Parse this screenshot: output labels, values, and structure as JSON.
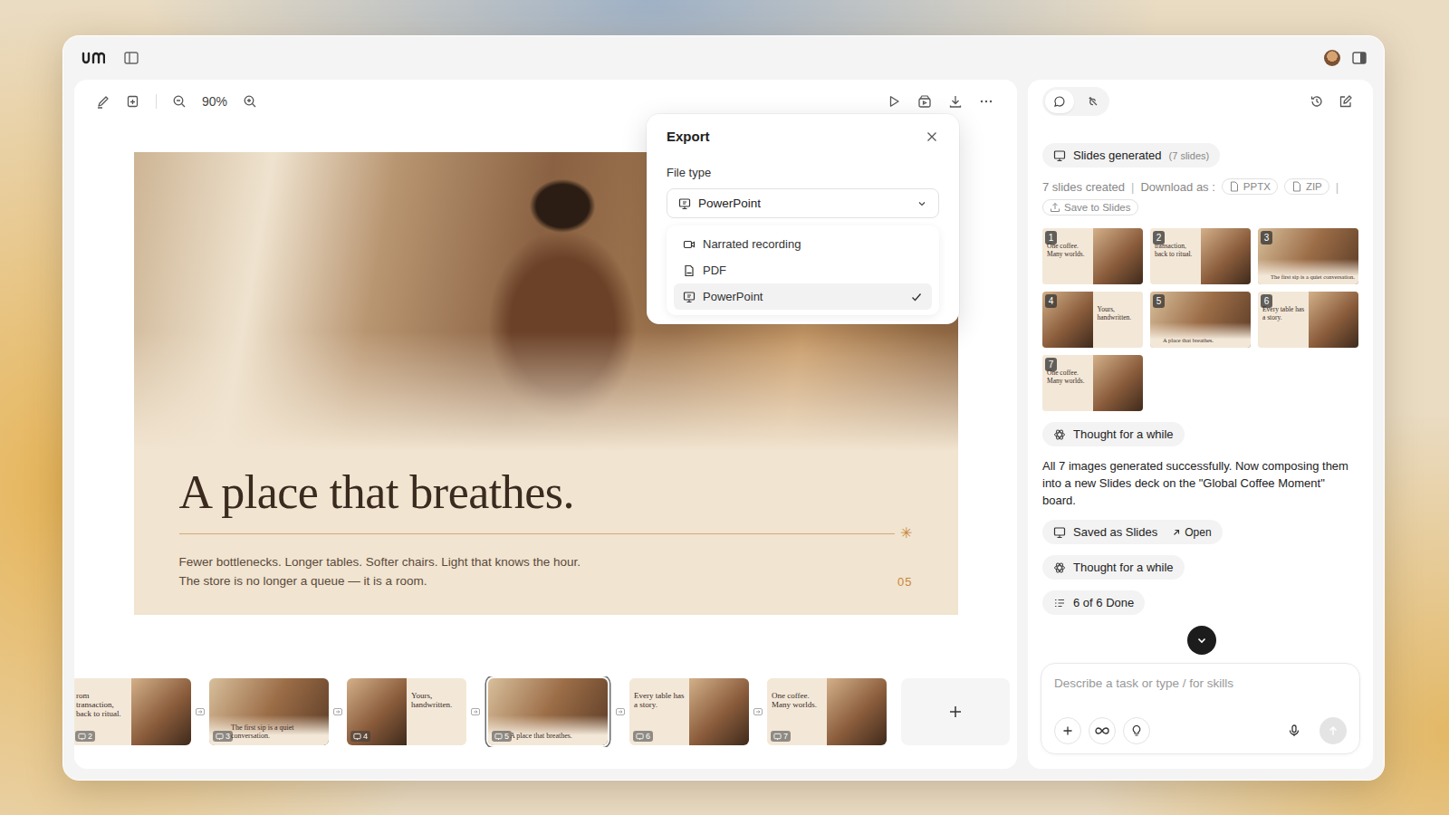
{
  "toolbar": {
    "zoom": "90%"
  },
  "slide": {
    "title": "A place that breathes.",
    "lines": [
      "Fewer bottlenecks. Longer tables. Softer chairs. Light that knows the hour.",
      "The store is no longer a queue — it is a room."
    ],
    "ornament": "✳",
    "page": "05"
  },
  "export": {
    "title": "Export",
    "field_label": "File type",
    "value": "PowerPoint",
    "options": [
      {
        "label": "Narrated recording",
        "kind": "video",
        "selected": false
      },
      {
        "label": "PDF",
        "kind": "pdf",
        "selected": false
      },
      {
        "label": "PowerPoint",
        "kind": "slides",
        "selected": true
      }
    ]
  },
  "filmstrip": [
    {
      "number": "2",
      "caption": "rom transaction, back to ritual.",
      "kind": "text-left",
      "selected": false
    },
    {
      "number": "3",
      "caption": "The first sip is a quiet conversation.",
      "kind": "full",
      "selected": false
    },
    {
      "number": "4",
      "caption": "Yours, handwritten.",
      "kind": "text-right",
      "selected": false
    },
    {
      "number": "5",
      "caption": "A place that breathes.",
      "kind": "full",
      "selected": true
    },
    {
      "number": "6",
      "caption": "Every table has a story.",
      "kind": "text-left",
      "selected": false
    },
    {
      "number": "7",
      "caption": "One coffee. Many worlds.",
      "kind": "text-left",
      "selected": false
    }
  ],
  "chat": {
    "tabs": [
      {
        "name": "chat",
        "selected": true
      },
      {
        "name": "agent",
        "selected": false
      }
    ],
    "slides_chip": {
      "label": "Slides generated",
      "count": "(7 slides)"
    },
    "download": {
      "status": "7 slides created",
      "separator": "|",
      "label": "Download as :",
      "formats": [
        "PPTX",
        "ZIP"
      ],
      "save": "Save to Slides"
    },
    "thumbnails": [
      {
        "number": "1",
        "caption": "One coffee. Many worlds.",
        "kind": "text-left"
      },
      {
        "number": "2",
        "caption": "transaction, back to ritual.",
        "kind": "text-left"
      },
      {
        "number": "3",
        "caption": "The first sip is a quiet conversation.",
        "kind": "full"
      },
      {
        "number": "4",
        "caption": "Yours, handwritten.",
        "kind": "text-right"
      },
      {
        "number": "5",
        "caption": "A place that breathes.",
        "kind": "full"
      },
      {
        "number": "6",
        "caption": "Every table has a story.",
        "kind": "text-left"
      },
      {
        "number": "7",
        "caption": "One coffee. Many worlds.",
        "kind": "text-left"
      }
    ],
    "messages": [
      {
        "kind": "thought",
        "label": "Thought for a while"
      },
      {
        "kind": "text",
        "label": "All 7 images generated successfully. Now composing them into a new Slides deck on the \"Global Coffee Moment\" board."
      },
      {
        "kind": "saved",
        "label": "Saved as Slides",
        "action": "Open"
      },
      {
        "kind": "thought",
        "label": "Thought for a while"
      },
      {
        "kind": "tasks",
        "label": "6 of 6 Done"
      }
    ],
    "input": {
      "placeholder": "Describe a task or type / for skills",
      "send_enabled": false
    }
  }
}
